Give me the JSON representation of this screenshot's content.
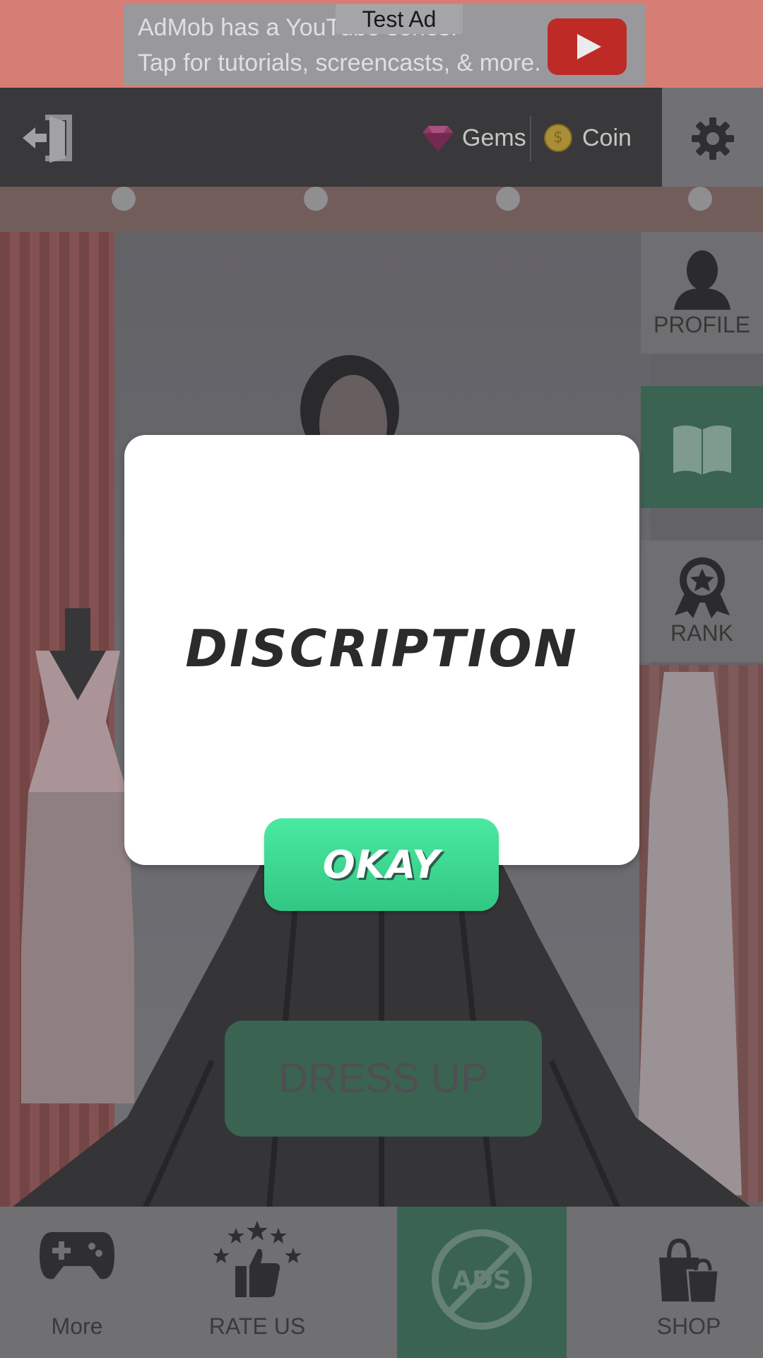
{
  "ad": {
    "line1": "AdMob has a YouTube series!",
    "line2": "Tap for tutorials, screencasts, & more.",
    "tag": "Test Ad",
    "play_icon": "play-icon"
  },
  "top_bar": {
    "exit_icon": "exit-door-icon",
    "gems_label": "Gems",
    "gems_icon": "gem-icon",
    "coin_label": "Coin",
    "coin_icon": "coin-icon",
    "coin_symbol": "$",
    "settings_icon": "gear-icon"
  },
  "side_menu": {
    "items": [
      {
        "label": "PROFILE",
        "icon": "profile-icon"
      },
      {
        "label": "",
        "icon": "book-icon"
      },
      {
        "label": "RANK",
        "icon": "rank-badge-icon"
      }
    ]
  },
  "main": {
    "dress_up_label": "DRESS UP"
  },
  "bottom_nav": {
    "items": [
      {
        "label": "More",
        "icon": "gamepad-icon"
      },
      {
        "label": "RATE US",
        "icon": "thumbs-up-stars-icon"
      },
      {
        "label": "",
        "icon": "no-ads-icon",
        "icon_text": "ADS"
      },
      {
        "label": "SHOP",
        "icon": "shopping-bag-icon"
      }
    ]
  },
  "dialog": {
    "title": "DISCRIPTION",
    "okay_label": "OKAY"
  },
  "colors": {
    "accent_green": "#3fd991",
    "dialog_bg": "#ffffff",
    "active_tile": "#3f6c59"
  }
}
